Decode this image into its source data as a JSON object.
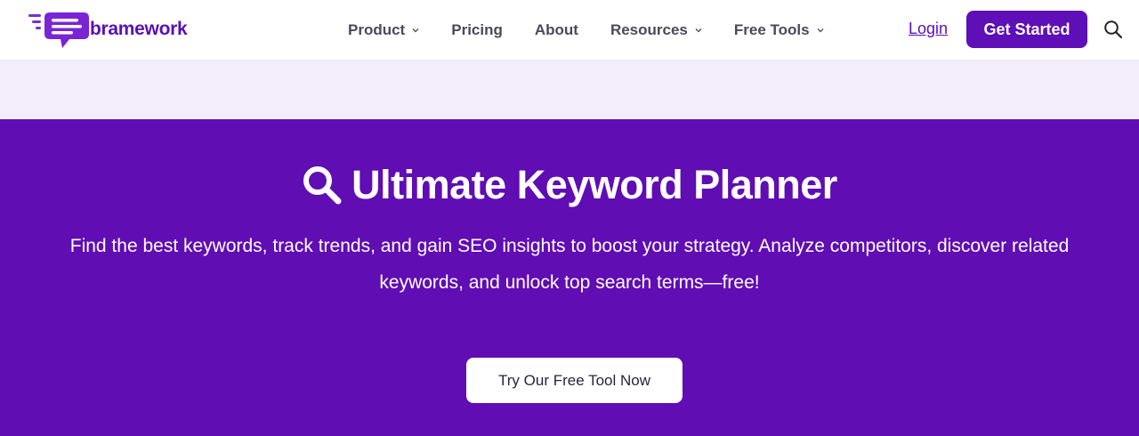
{
  "brand": {
    "name": "bramework",
    "color": "#5b0fb5"
  },
  "nav": {
    "items": [
      {
        "label": "Product",
        "has_dropdown": true
      },
      {
        "label": "Pricing",
        "has_dropdown": false
      },
      {
        "label": "About",
        "has_dropdown": false
      },
      {
        "label": "Resources",
        "has_dropdown": true
      },
      {
        "label": "Free Tools",
        "has_dropdown": true
      }
    ],
    "login_label": "Login",
    "cta_label": "Get Started",
    "search_icon": "search-icon"
  },
  "hero": {
    "icon": "magnifier-icon",
    "title": "Ultimate Keyword Planner",
    "subtitle": "Find the best keywords, track trends, and gain SEO insights to boost your strategy. Analyze competitors, discover related keywords, and unlock top search terms—free!",
    "button_label": "Try Our Free Tool Now",
    "background": "#600db4"
  },
  "colors": {
    "accent": "#5e0fb7",
    "band": "#f3ecfb",
    "nav_text": "#4a4a5a"
  }
}
